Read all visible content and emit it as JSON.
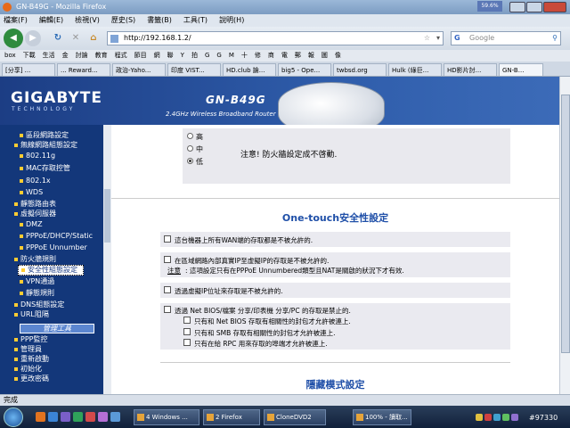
{
  "window": {
    "title": "GN-B49G - Mozilla Firefox",
    "mini_label": "59.6%"
  },
  "menu": [
    "檔案(F)",
    "編輯(E)",
    "檢視(V)",
    "歷史(S)",
    "書籤(B)",
    "工具(T)",
    "說明(H)"
  ],
  "nav": {
    "url": "http://192.168.1.2/",
    "search_placeholder": "Google"
  },
  "bookmarks": [
    "box",
    "下載",
    "生活",
    "金",
    "討論",
    "教育",
    "程式",
    "節目",
    "網",
    "聯",
    "Y",
    "拍",
    "G",
    "G",
    "M",
    "十",
    "修",
    "商",
    "電",
    "郵",
    "報",
    "圖",
    "像"
  ],
  "tabs": [
    "[分享] ...",
    "... Reward...",
    "政治-Yaho...",
    "印度 VIST...",
    "HD.club 論...",
    "big5 - Ope...",
    "twbsd.org",
    "Hulk (綠巨...",
    "HD影片討...",
    "GN-B..."
  ],
  "header": {
    "brand": "GIGABYTE",
    "brand_sub": "TECHNOLOGY",
    "model": "GN-B49G",
    "tagline": "2.4GHz Wireless Broadband Router"
  },
  "sidebar": {
    "items": [
      "區段網路設定",
      "無線網路組態設定",
      "802.11g",
      "MAC存取控管",
      "802.1x",
      "WDS",
      "靜態路由表",
      "虛擬伺服器",
      "DMZ",
      "PPPoE/DHCP/Static",
      "PPPoE Unnumber",
      "防火牆規則",
      "安全性組態設定",
      "VPN通過",
      "靜態規則",
      "DNS組態設定",
      "URL阻隔",
      "PPP監控",
      "管理員",
      "重新啟動",
      "初始化",
      "更改密碼"
    ],
    "tool_header": "管理工具"
  },
  "content": {
    "levels": [
      "高",
      "中",
      "低"
    ],
    "notice": "注意! 防火牆設定成不啓動.",
    "section1_title": "One-touch安全性設定",
    "opt1": "這台機器上所有WAN端的存取都是不被允許的.",
    "opt2_line1": "在區域網路內部真實IP至虛擬IP的存取是不被允許的.",
    "opt2_note_label": "注意",
    "opt2_note": ": 這項設定只有在PPPoE Unnumbered類型且NAT是關啟的狀況下才有效.",
    "opt3": "透過虛擬IP位址來存取是不被允許的.",
    "opt4": "透過 Net BIOS/檔案 分享/印表機 分享/PC 的存取是禁止的.",
    "opt4_sub": [
      "只有和 Net BIOS 存取有相關性的封包才允許被連上.",
      "只有和 SMB 存取有相關性的封包才允許被連上.",
      "只有在給 RPC 用來存取的埠端才允許被連上."
    ],
    "section2_title": "隱藏模式設定"
  },
  "status": "完成",
  "taskbar": {
    "tasks": [
      "4 Windows ...",
      "2 Firefox",
      "CloneDVD2",
      "100% - 讀取..."
    ],
    "clock": "#97330"
  }
}
